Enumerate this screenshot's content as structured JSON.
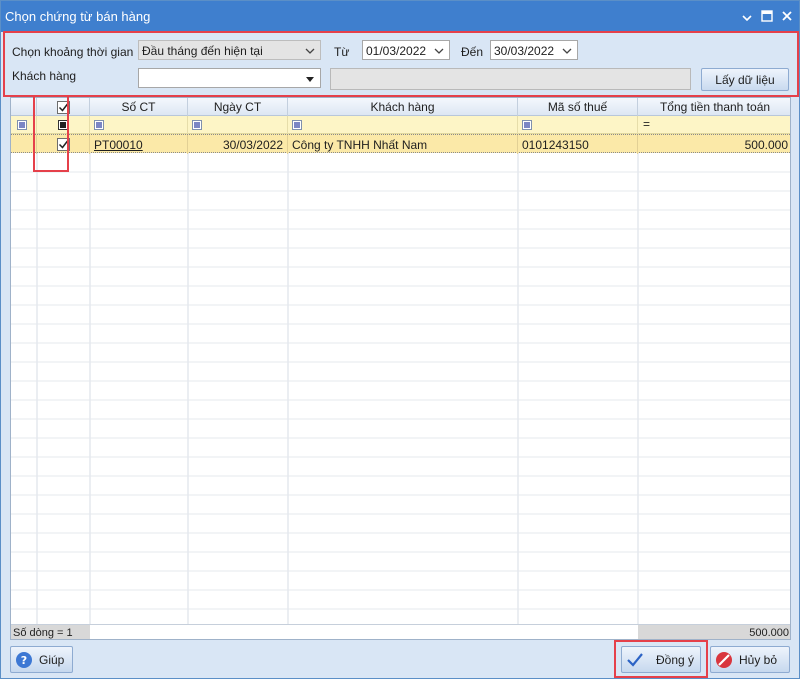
{
  "window": {
    "title": "Chọn chứng từ bán hàng"
  },
  "filter": {
    "period_label": "Chọn khoảng thời gian",
    "period_value": "Đầu tháng đến hiện tại",
    "from_label": "Từ",
    "from_value": "01/03/2022",
    "to_label": "Đến",
    "to_value": "30/03/2022",
    "customer_label": "Khách hàng",
    "customer_value": "",
    "customer_name_value": "",
    "fetch_button": "Lấy dữ liệu"
  },
  "grid": {
    "columns": [
      "Số CT",
      "Ngày CT",
      "Khách hàng",
      "Mã số thuế",
      "Tổng tiền thanh toán"
    ],
    "filter_row_sum_symbol": "=",
    "rows": [
      {
        "checked": true,
        "so_ct": "PT00010",
        "ngay_ct": "30/03/2022",
        "khach_hang": "Công ty TNHH Nhất Nam",
        "ma_so_thue": "0101243150",
        "tong_tien": "500.000"
      }
    ],
    "footer_count": "Số dòng = 1",
    "footer_total": "500.000"
  },
  "buttons": {
    "help": "Giúp",
    "ok": "Đồng ý",
    "cancel": "Hủy bỏ"
  },
  "colors": {
    "titlebar": "#3f7fce",
    "highlight": "#e5404a",
    "filter_row": "#fdf5c6",
    "selected_row": "#fbe9a8"
  }
}
